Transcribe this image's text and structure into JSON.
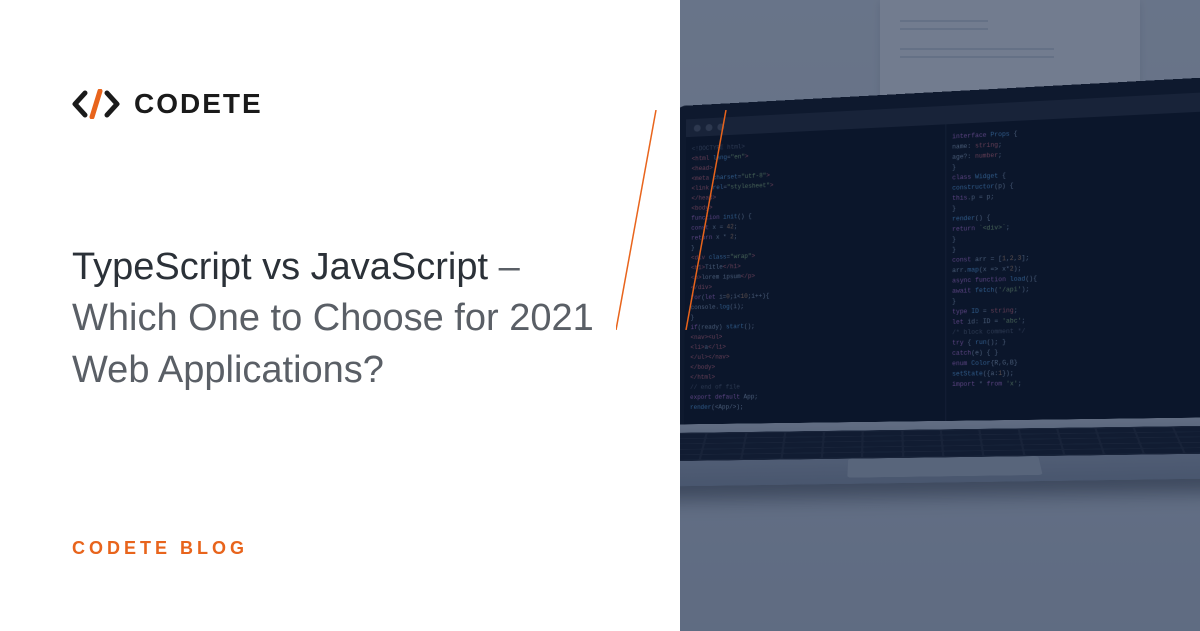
{
  "brand": {
    "name": "CODETE",
    "accent_color": "#e8641c"
  },
  "headline": {
    "strong": "TypeScript vs JavaScript",
    "rest": "– Which One to Choose for 2021 Web Applications?"
  },
  "category": "CODETE BLOG",
  "image": {
    "description": "Laptop on desk showing code editor with syntax-highlighted source code, paper document in background"
  }
}
